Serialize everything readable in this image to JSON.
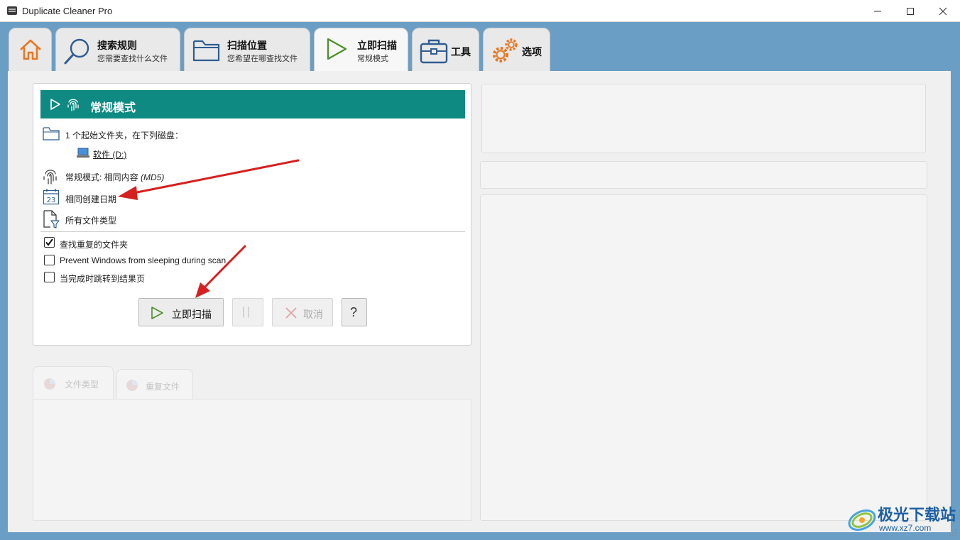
{
  "window": {
    "title": "Duplicate Cleaner Pro"
  },
  "tabs": {
    "home": {
      "icon": "home-icon"
    },
    "search_rules": {
      "label": "搜索规则",
      "sub": "您需要查找什么文件"
    },
    "scan_location": {
      "label": "扫描位置",
      "sub": "您希望在哪查找文件"
    },
    "scan_now": {
      "label": "立即扫描",
      "sub": "常规模式"
    },
    "tools": {
      "label": "工具"
    },
    "options": {
      "label": "选项"
    }
  },
  "scan": {
    "mode_title": "常规模式",
    "folders_line": "1 个起始文件夹，在下列磁盘：",
    "drive": "软件 (D:)",
    "mode_line": "常规模式: 相同内容",
    "mode_hash": "(MD5)",
    "date_line": "相同创建日期",
    "filetype_line": "所有文件类型"
  },
  "checkboxes": [
    {
      "label": "查找重复的文件夹",
      "checked": true
    },
    {
      "label": "Prevent Windows from sleeping during scan",
      "checked": false
    },
    {
      "label": "当完成时跳转到结果页",
      "checked": false
    }
  ],
  "buttons": {
    "scan_now": "立即扫描",
    "pause": "||",
    "cancel": "取消",
    "help": "?"
  },
  "lower_tabs": {
    "file_types": "文件类型",
    "duplicate_files": "重复文件"
  },
  "watermark": {
    "text": "极光下载站",
    "url": "www.xz7.com"
  },
  "colors": {
    "mode_bar": "#0f8a82",
    "annotation_arrow": "#d6201f",
    "titlebar_bg": "#6b9ec4"
  }
}
